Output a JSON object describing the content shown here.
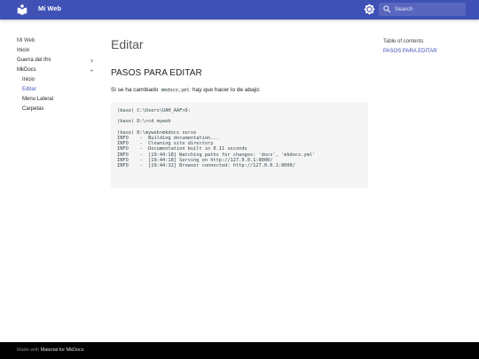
{
  "header": {
    "site_title": "Mi Web",
    "logo_icon": "book-open-icon",
    "palette_icon": "brightness-gear-icon",
    "search_placeholder": "Search",
    "accent_color": "#4051b5"
  },
  "nav": {
    "items": [
      {
        "label": "Mi Web",
        "kind": "title"
      },
      {
        "label": "Inicio"
      },
      {
        "label": "Guerra del Ifni",
        "expandable": true
      },
      {
        "label": "MkDocs",
        "expandable": true,
        "expanded": true
      },
      {
        "label": "Inicio",
        "child": true
      },
      {
        "label": "Editar",
        "child": true,
        "active": true
      },
      {
        "label": "Menu Lateral",
        "child": true
      },
      {
        "label": "Carpetas",
        "child": true
      }
    ]
  },
  "main": {
    "page_title": "Editar",
    "section_title": "PASOS PARA EDITAR",
    "paragraph_before": "Si se ha cambiado ",
    "paragraph_code": "mkdocs.yml",
    "paragraph_after": " hay que hacer lo de abajo:",
    "code_lines": [
      "(base) C:\\Users\\UAH_AAF>D:",
      "",
      "(base) D:\\>cd myweb",
      "",
      "(base) D:\\myweb>mkdocs serve",
      "INFO    -  Building documentation...",
      "INFO    -  Cleaning site directory",
      "INFO    -  Documentation built in 0.11 seconds",
      "INFO    -  [19:44:18] Watching paths for changes: 'docs', 'mkdocs.yml'",
      "INFO    -  [19:44:18] Serving on http://127.0.0.1:8000/",
      "INFO    -  [19:44:32] Browser connected: http://127.0.0.1:8000/"
    ]
  },
  "toc": {
    "title": "Table of contents",
    "links": [
      "PASOS PARA EDITAR"
    ]
  },
  "footer": {
    "prefix": "Made with ",
    "link": "Material for MkDocs"
  }
}
